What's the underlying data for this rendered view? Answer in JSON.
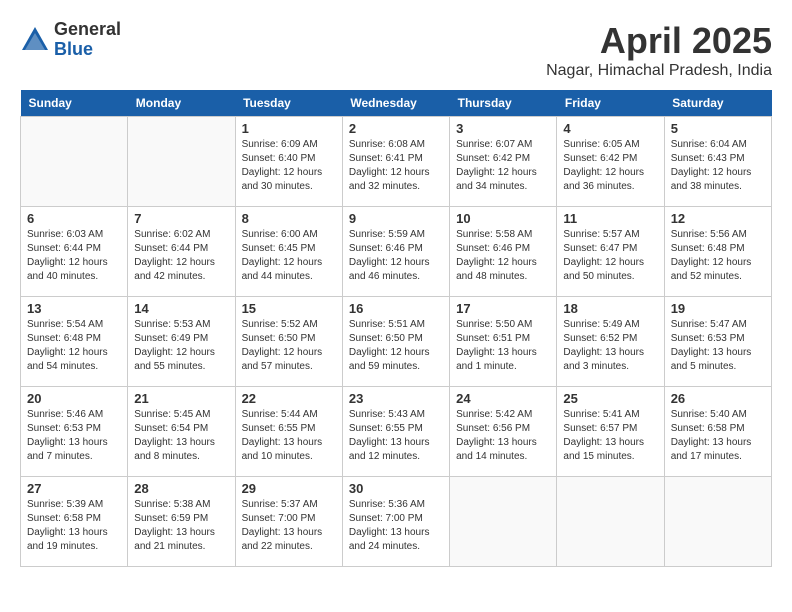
{
  "logo": {
    "general": "General",
    "blue": "Blue"
  },
  "title": "April 2025",
  "location": "Nagar, Himachal Pradesh, India",
  "weekdays": [
    "Sunday",
    "Monday",
    "Tuesday",
    "Wednesday",
    "Thursday",
    "Friday",
    "Saturday"
  ],
  "weeks": [
    [
      {
        "day": "",
        "info": ""
      },
      {
        "day": "",
        "info": ""
      },
      {
        "day": "1",
        "info": "Sunrise: 6:09 AM\nSunset: 6:40 PM\nDaylight: 12 hours\nand 30 minutes."
      },
      {
        "day": "2",
        "info": "Sunrise: 6:08 AM\nSunset: 6:41 PM\nDaylight: 12 hours\nand 32 minutes."
      },
      {
        "day": "3",
        "info": "Sunrise: 6:07 AM\nSunset: 6:42 PM\nDaylight: 12 hours\nand 34 minutes."
      },
      {
        "day": "4",
        "info": "Sunrise: 6:05 AM\nSunset: 6:42 PM\nDaylight: 12 hours\nand 36 minutes."
      },
      {
        "day": "5",
        "info": "Sunrise: 6:04 AM\nSunset: 6:43 PM\nDaylight: 12 hours\nand 38 minutes."
      }
    ],
    [
      {
        "day": "6",
        "info": "Sunrise: 6:03 AM\nSunset: 6:44 PM\nDaylight: 12 hours\nand 40 minutes."
      },
      {
        "day": "7",
        "info": "Sunrise: 6:02 AM\nSunset: 6:44 PM\nDaylight: 12 hours\nand 42 minutes."
      },
      {
        "day": "8",
        "info": "Sunrise: 6:00 AM\nSunset: 6:45 PM\nDaylight: 12 hours\nand 44 minutes."
      },
      {
        "day": "9",
        "info": "Sunrise: 5:59 AM\nSunset: 6:46 PM\nDaylight: 12 hours\nand 46 minutes."
      },
      {
        "day": "10",
        "info": "Sunrise: 5:58 AM\nSunset: 6:46 PM\nDaylight: 12 hours\nand 48 minutes."
      },
      {
        "day": "11",
        "info": "Sunrise: 5:57 AM\nSunset: 6:47 PM\nDaylight: 12 hours\nand 50 minutes."
      },
      {
        "day": "12",
        "info": "Sunrise: 5:56 AM\nSunset: 6:48 PM\nDaylight: 12 hours\nand 52 minutes."
      }
    ],
    [
      {
        "day": "13",
        "info": "Sunrise: 5:54 AM\nSunset: 6:48 PM\nDaylight: 12 hours\nand 54 minutes."
      },
      {
        "day": "14",
        "info": "Sunrise: 5:53 AM\nSunset: 6:49 PM\nDaylight: 12 hours\nand 55 minutes."
      },
      {
        "day": "15",
        "info": "Sunrise: 5:52 AM\nSunset: 6:50 PM\nDaylight: 12 hours\nand 57 minutes."
      },
      {
        "day": "16",
        "info": "Sunrise: 5:51 AM\nSunset: 6:50 PM\nDaylight: 12 hours\nand 59 minutes."
      },
      {
        "day": "17",
        "info": "Sunrise: 5:50 AM\nSunset: 6:51 PM\nDaylight: 13 hours\nand 1 minute."
      },
      {
        "day": "18",
        "info": "Sunrise: 5:49 AM\nSunset: 6:52 PM\nDaylight: 13 hours\nand 3 minutes."
      },
      {
        "day": "19",
        "info": "Sunrise: 5:47 AM\nSunset: 6:53 PM\nDaylight: 13 hours\nand 5 minutes."
      }
    ],
    [
      {
        "day": "20",
        "info": "Sunrise: 5:46 AM\nSunset: 6:53 PM\nDaylight: 13 hours\nand 7 minutes."
      },
      {
        "day": "21",
        "info": "Sunrise: 5:45 AM\nSunset: 6:54 PM\nDaylight: 13 hours\nand 8 minutes."
      },
      {
        "day": "22",
        "info": "Sunrise: 5:44 AM\nSunset: 6:55 PM\nDaylight: 13 hours\nand 10 minutes."
      },
      {
        "day": "23",
        "info": "Sunrise: 5:43 AM\nSunset: 6:55 PM\nDaylight: 13 hours\nand 12 minutes."
      },
      {
        "day": "24",
        "info": "Sunrise: 5:42 AM\nSunset: 6:56 PM\nDaylight: 13 hours\nand 14 minutes."
      },
      {
        "day": "25",
        "info": "Sunrise: 5:41 AM\nSunset: 6:57 PM\nDaylight: 13 hours\nand 15 minutes."
      },
      {
        "day": "26",
        "info": "Sunrise: 5:40 AM\nSunset: 6:58 PM\nDaylight: 13 hours\nand 17 minutes."
      }
    ],
    [
      {
        "day": "27",
        "info": "Sunrise: 5:39 AM\nSunset: 6:58 PM\nDaylight: 13 hours\nand 19 minutes."
      },
      {
        "day": "28",
        "info": "Sunrise: 5:38 AM\nSunset: 6:59 PM\nDaylight: 13 hours\nand 21 minutes."
      },
      {
        "day": "29",
        "info": "Sunrise: 5:37 AM\nSunset: 7:00 PM\nDaylight: 13 hours\nand 22 minutes."
      },
      {
        "day": "30",
        "info": "Sunrise: 5:36 AM\nSunset: 7:00 PM\nDaylight: 13 hours\nand 24 minutes."
      },
      {
        "day": "",
        "info": ""
      },
      {
        "day": "",
        "info": ""
      },
      {
        "day": "",
        "info": ""
      }
    ]
  ]
}
